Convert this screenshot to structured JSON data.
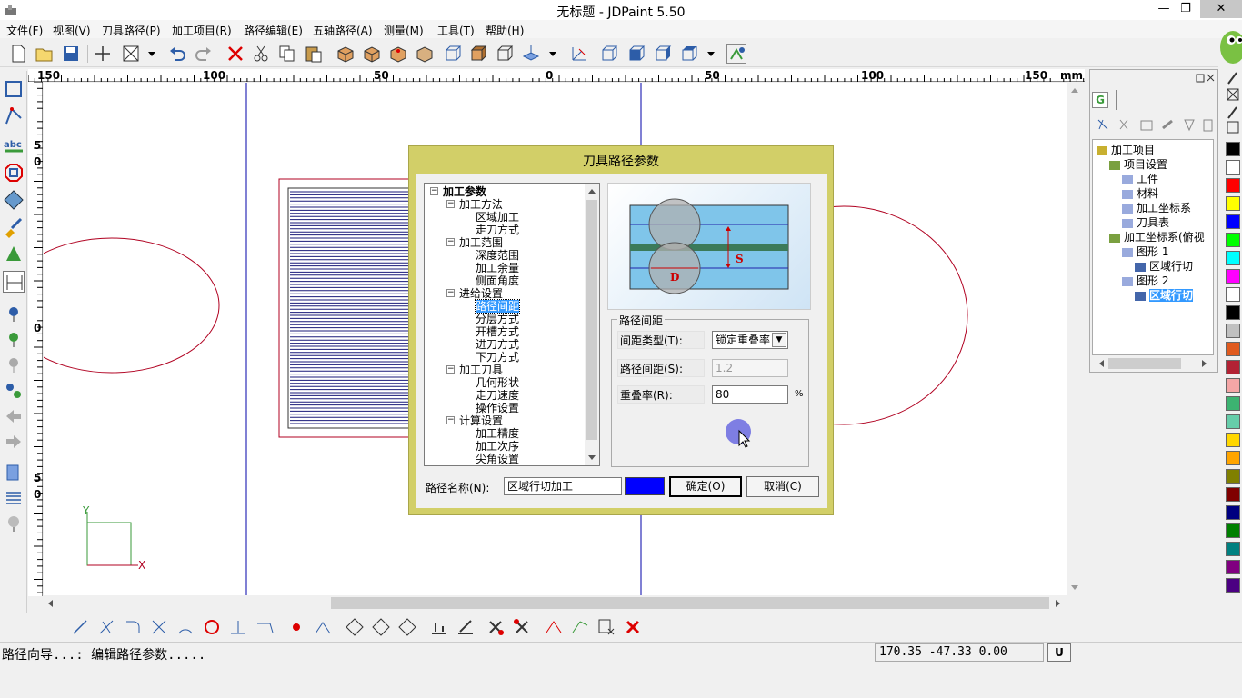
{
  "window": {
    "title": "无标题 - JDPaint 5.50",
    "minimize": "—",
    "restore": "❐",
    "close": "✕"
  },
  "menu": [
    "文件(F)",
    "视图(V)",
    "刀具路径(P)",
    "加工项目(R)",
    "路径编辑(E)",
    "五轴路径(A)",
    "测量(M)",
    "工具(T)",
    "帮助(H)"
  ],
  "ruler": {
    "unit": "mm",
    "h_labels": [
      "150",
      "100",
      "50",
      "0",
      "50",
      "100",
      "150"
    ],
    "v_labels": [
      "5",
      "0",
      "0",
      "5",
      "0"
    ]
  },
  "canvas_axes": {
    "x_label": "X",
    "y_label": "Y"
  },
  "right_panel": {
    "tab_g": "G",
    "tree": [
      {
        "label": "加工项目",
        "level": 0
      },
      {
        "label": "项目设置",
        "level": 1
      },
      {
        "label": "工件",
        "level": 2
      },
      {
        "label": "材料",
        "level": 2
      },
      {
        "label": "加工坐标系",
        "level": 2
      },
      {
        "label": "刀具表",
        "level": 2
      },
      {
        "label": "加工坐标系(俯视",
        "level": 1
      },
      {
        "label": "图形 1",
        "level": 2
      },
      {
        "label": "区域行切",
        "level": 3
      },
      {
        "label": "图形 2",
        "level": 2
      },
      {
        "label": "区域行切",
        "level": 3,
        "selected": true
      }
    ]
  },
  "palette": [
    "#000000",
    "#ffffff",
    "#ff0000",
    "#ffff00",
    "#0000ff",
    "#00ff00",
    "#00ffff",
    "#ff00ff",
    "#ffffff",
    "#000000",
    "#c0c0c0",
    "#e05a1e",
    "#b22234",
    "#f4a6a6",
    "#3cb371",
    "#66cdaa",
    "#ffd700",
    "#ffa500",
    "#808000",
    "#800000",
    "#000080",
    "#008000",
    "#008080",
    "#800080",
    "#4b0082"
  ],
  "dialog": {
    "title": "刀具路径参数",
    "tree": [
      {
        "label": "加工参数",
        "level": 0,
        "bold": true,
        "expander": "−"
      },
      {
        "label": "加工方法",
        "level": 1,
        "expander": "−"
      },
      {
        "label": "区域加工",
        "level": 2
      },
      {
        "label": "走刀方式",
        "level": 2
      },
      {
        "label": "加工范围",
        "level": 1,
        "expander": "−"
      },
      {
        "label": "深度范围",
        "level": 2
      },
      {
        "label": "加工余量",
        "level": 2
      },
      {
        "label": "侧面角度",
        "level": 2
      },
      {
        "label": "进给设置",
        "level": 1,
        "expander": "−"
      },
      {
        "label": "路径间距",
        "level": 2,
        "selected": true
      },
      {
        "label": "分层方式",
        "level": 2
      },
      {
        "label": "开槽方式",
        "level": 2
      },
      {
        "label": "进刀方式",
        "level": 2
      },
      {
        "label": "下刀方式",
        "level": 2
      },
      {
        "label": "加工刀具",
        "level": 1,
        "expander": "−"
      },
      {
        "label": "几何形状",
        "level": 2
      },
      {
        "label": "走刀速度",
        "level": 2
      },
      {
        "label": "操作设置",
        "level": 2
      },
      {
        "label": "计算设置",
        "level": 1,
        "expander": "−"
      },
      {
        "label": "加工精度",
        "level": 2
      },
      {
        "label": "加工次序",
        "level": 2
      },
      {
        "label": "尖角设置",
        "level": 2
      }
    ],
    "preview_labels": {
      "s": "S",
      "d": "D"
    },
    "group_title": "路径间距",
    "fields": {
      "spacing_type_label": "间距类型(T):",
      "spacing_type_value": "锁定重叠率",
      "spacing_label": "路径间距(S):",
      "spacing_value": "1.2",
      "overlap_label": "重叠率(R):",
      "overlap_value": "80",
      "overlap_unit": "%"
    },
    "name_label": "路径名称(N):",
    "name_value": "区域行切加工",
    "path_color": "#0000ff",
    "ok": "确定(O)",
    "cancel": "取消(C)"
  },
  "status": {
    "message": "路径向导...: 编辑路径参数.....",
    "coords": "170.35 -47.33 0.00",
    "unit_button": "U"
  }
}
